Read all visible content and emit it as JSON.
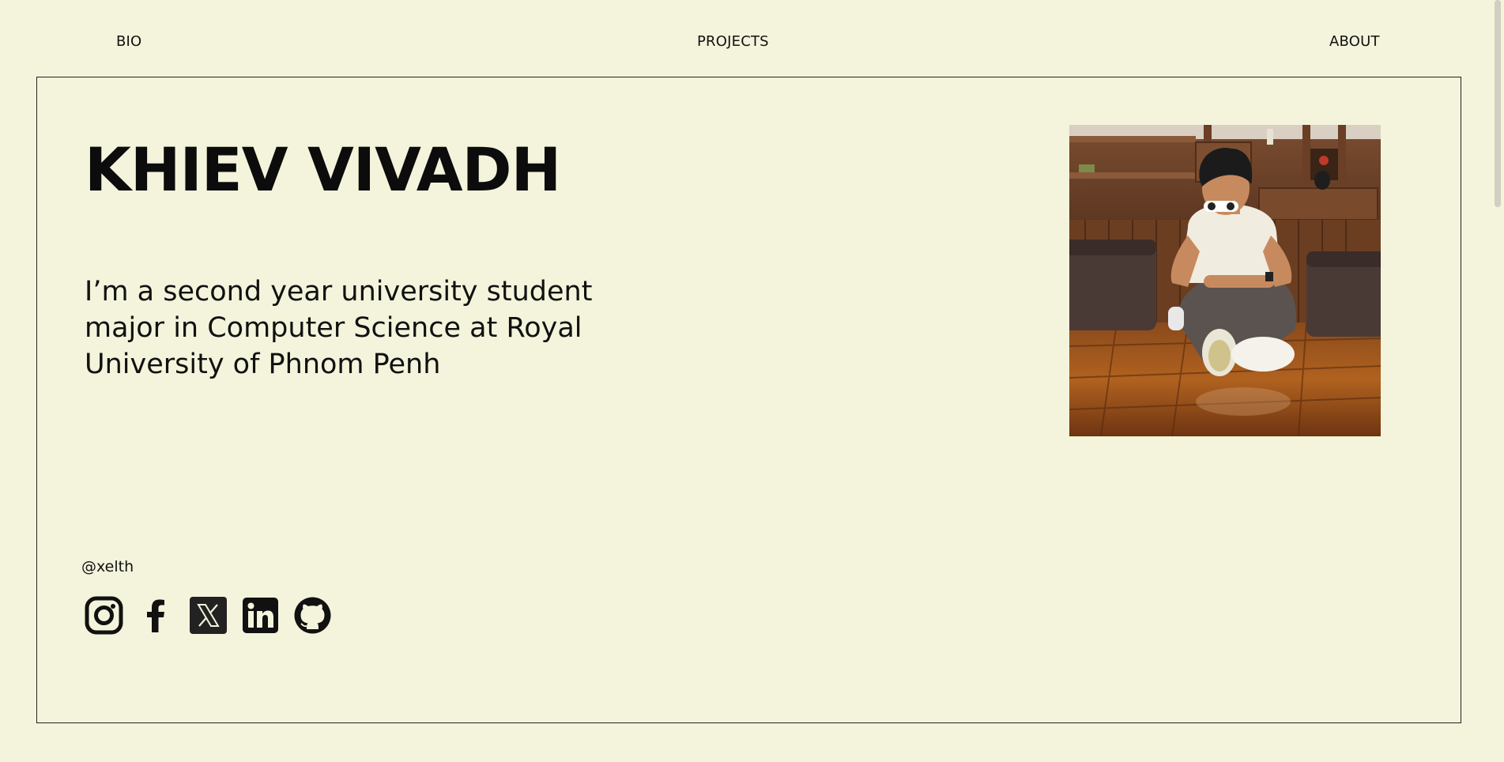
{
  "nav": {
    "bio": "BIO",
    "projects": "PROJECTS",
    "about": "ABOUT"
  },
  "hero": {
    "name": "KHIEV VIVADH",
    "bio": "I’m a second year university student major in Computer Science at Royal University of Phnom Penh"
  },
  "social": {
    "handle": "@xelth",
    "icons": [
      "instagram-icon",
      "facebook-icon",
      "x-twitter-icon",
      "linkedin-icon",
      "github-icon"
    ]
  },
  "colors": {
    "background": "#f4f4dc",
    "text": "#111111",
    "border": "#222222"
  }
}
